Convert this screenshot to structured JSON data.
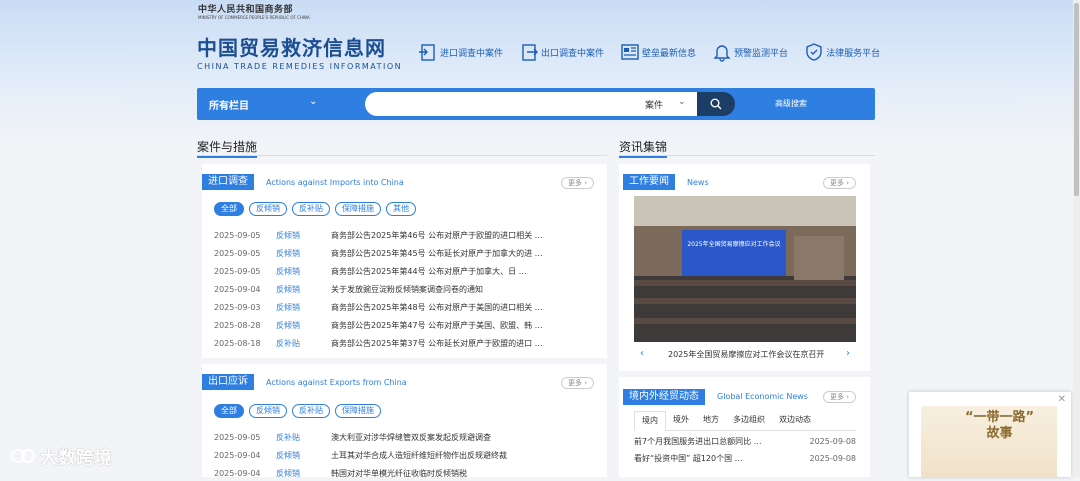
{
  "header": {
    "ministry_cn": "中华人民共和国商务部",
    "ministry_en": "MINISTRY OF COMMERCE PEOPLE'S REPUBLIC OF CHINA",
    "site_title": "中国贸易救济信息网",
    "site_subtitle": "CHINA TRADE REMEDIES INFORMATION",
    "nav": [
      "进口调查中案件",
      "出口调查中案件",
      "壁垒最新信息",
      "预警监测平台",
      "法律服务平台"
    ]
  },
  "search": {
    "scope_label": "所有栏目",
    "type_label": "案件",
    "advanced_label": "高级搜索"
  },
  "left_section_title": "案件与措施",
  "right_section_title": "资讯集锦",
  "import_panel": {
    "tag": "进口调查",
    "subtitle": "Actions against Imports into China",
    "more": "更多",
    "filters": [
      "全部",
      "反倾销",
      "反补贴",
      "保障措施",
      "其他"
    ],
    "rows": [
      {
        "date": "2025-09-05",
        "cat": "反倾销",
        "title": "商务部公告2025年第46号 公布对原产于欧盟的进口相关 …"
      },
      {
        "date": "2025-09-05",
        "cat": "反倾销",
        "title": "商务部公告2025年第45号 公布延长对原产于加拿大的进 …"
      },
      {
        "date": "2025-09-05",
        "cat": "反倾销",
        "title": "商务部公告2025年第44号 公布对原产于加拿大、日 …"
      },
      {
        "date": "2025-09-04",
        "cat": "反倾销",
        "title": "关于发放豌豆淀粉反倾销案调查问卷的通知"
      },
      {
        "date": "2025-09-03",
        "cat": "反倾销",
        "title": "商务部公告2025年第48号 公布对原产于美国的进口相关 …"
      },
      {
        "date": "2025-08-28",
        "cat": "反倾销",
        "title": "商务部公告2025年第47号 公布对原产于美国、欧盟、韩 …"
      },
      {
        "date": "2025-08-18",
        "cat": "反补贴",
        "title": "商务部公告2025年第37号 公布延长对原产于欧盟的进口 …"
      }
    ]
  },
  "export_panel": {
    "tag": "出口应诉",
    "subtitle": "Actions against Exports from China",
    "more": "更多",
    "filters": [
      "全部",
      "反倾销",
      "反补贴",
      "保障措施"
    ],
    "rows": [
      {
        "date": "2025-09-05",
        "cat": "反补贴",
        "title": "澳大利亚对涉华焊缝管双反案发起反规避调查"
      },
      {
        "date": "2025-09-04",
        "cat": "反倾销",
        "title": "土耳其对华合成人造短纤维短纤物作出反规避终裁"
      },
      {
        "date": "2025-09-04",
        "cat": "反倾销",
        "title": "韩国对对华单模光纤征收临时反倾销税"
      }
    ]
  },
  "work_panel": {
    "tag": "工作要闻",
    "subtitle": "News",
    "more": "更多",
    "photo_banner": "2025年全国贸易摩擦应对工作会议",
    "caption": "2025年全国贸易摩擦应对工作会议在京召开"
  },
  "econ_panel": {
    "tag": "境内外经贸动态",
    "subtitle": "Global Economic News",
    "more": "更多",
    "tabs": [
      "境内",
      "境外",
      "地方",
      "多边组织",
      "双边动态"
    ],
    "rows": [
      {
        "title": "前7个月我国服务进出口总额同比 …",
        "date": "2025-09-08"
      },
      {
        "title": "看好“投资中国” 超120个国 …",
        "date": "2025-09-08"
      }
    ]
  },
  "ad": {
    "line1": "“一带一路”",
    "line2": "故事",
    "close": "✕"
  },
  "watermark": "大数跨境"
}
